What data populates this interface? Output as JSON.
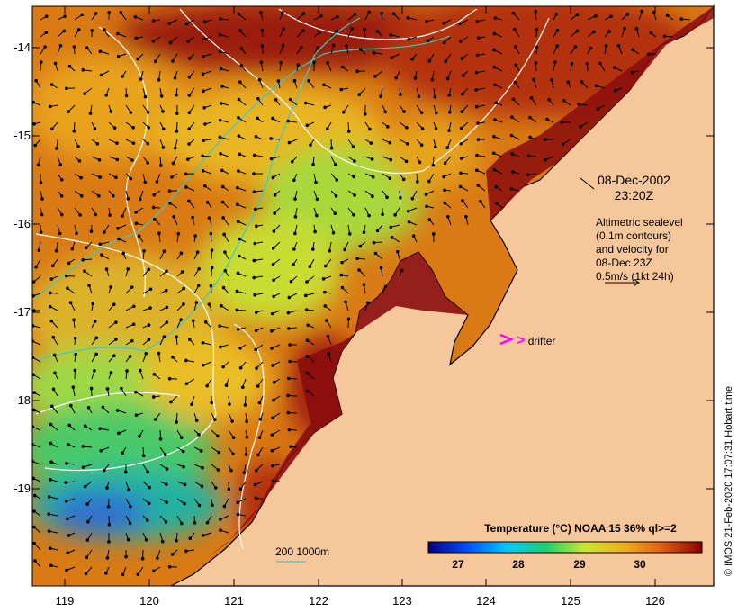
{
  "map": {
    "ocean_colors": [
      "#8a0d0d",
      "#b8360c",
      "#d66710",
      "#ec9a19",
      "#e6c62a",
      "#b5e23a",
      "#56d45c",
      "#1fb6a8",
      "#2a6fd6"
    ],
    "land_color": "#f7c79c",
    "coastline_color": "#000000"
  },
  "axes": {
    "y_ticks": [
      "-14",
      "-15",
      "-16",
      "-17",
      "-18",
      "-19"
    ],
    "x_ticks": [
      "119",
      "120",
      "121",
      "122",
      "123",
      "124",
      "125",
      "126"
    ]
  },
  "annotations": {
    "date": "08-Dec-2002",
    "time": "23:20Z",
    "altimetry_lines": [
      "Altimetric sealevel",
      "(0.1m contours)",
      "and velocity for",
      "08-Dec 23Z",
      "0.5m/s (1kt 24h)"
    ],
    "drifter_symbol": ">",
    "drifter_label": "drifter",
    "drifter_color": "#ff00ff",
    "depth_contours_label": "200  1000m"
  },
  "colorbar": {
    "title": "Temperature (°C) NOAA 15 36% ql>=2",
    "ticks": [
      "27",
      "28",
      "29",
      "30"
    ],
    "colors": [
      "#000080",
      "#0050ff",
      "#00c8ff",
      "#20d070",
      "#c8e830",
      "#f0b020",
      "#e06010",
      "#8b0000"
    ]
  },
  "copyright": "© IMOS 21-Feb-2020 17:07:31 Hobart time"
}
